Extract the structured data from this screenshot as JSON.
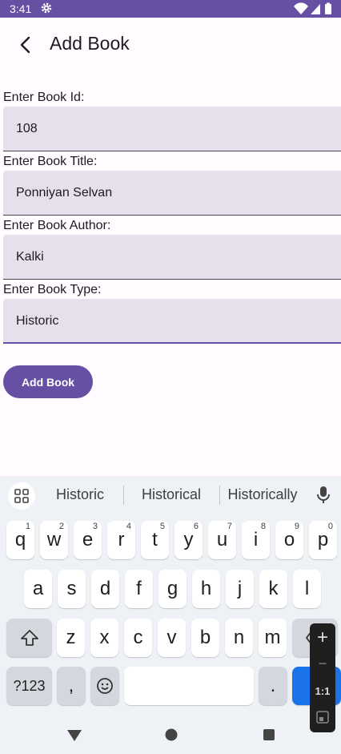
{
  "status_bar": {
    "time": "3:41",
    "icons": [
      "settings-icon",
      "wifi-icon",
      "signal-icon",
      "battery-icon"
    ]
  },
  "app_bar": {
    "title": "Add Book",
    "back_icon": "arrow-back-icon"
  },
  "form": {
    "fields": [
      {
        "label": "Enter Book Id:",
        "value": "108"
      },
      {
        "label": "Enter Book Title:",
        "value": "Ponniyan Selvan"
      },
      {
        "label": "Enter Book Author:",
        "value": "Kalki"
      },
      {
        "label": "Enter Book Type:",
        "value": "Historic"
      }
    ],
    "submit_label": "Add Book"
  },
  "keyboard": {
    "suggestions": [
      "Historic",
      "Historical",
      "Historically"
    ],
    "row1": [
      {
        "k": "q",
        "h": "1"
      },
      {
        "k": "w",
        "h": "2"
      },
      {
        "k": "e",
        "h": "3"
      },
      {
        "k": "r",
        "h": "4"
      },
      {
        "k": "t",
        "h": "5"
      },
      {
        "k": "y",
        "h": "6"
      },
      {
        "k": "u",
        "h": "7"
      },
      {
        "k": "i",
        "h": "8"
      },
      {
        "k": "o",
        "h": "9"
      },
      {
        "k": "p",
        "h": "0"
      }
    ],
    "row2": [
      "a",
      "s",
      "d",
      "f",
      "g",
      "h",
      "j",
      "k",
      "l"
    ],
    "row3": [
      "z",
      "x",
      "c",
      "v",
      "b",
      "n",
      "m"
    ],
    "symbols_label": "?123",
    "comma": ",",
    "period": "."
  },
  "zoom_overlay": {
    "plus": "+",
    "minus": "−",
    "ratio": "1:1"
  },
  "colors": {
    "primary": "#6750a4",
    "field_bg": "#e7e0ec",
    "keyboard_bg": "#eef1f6",
    "enter": "#1a73e8"
  }
}
